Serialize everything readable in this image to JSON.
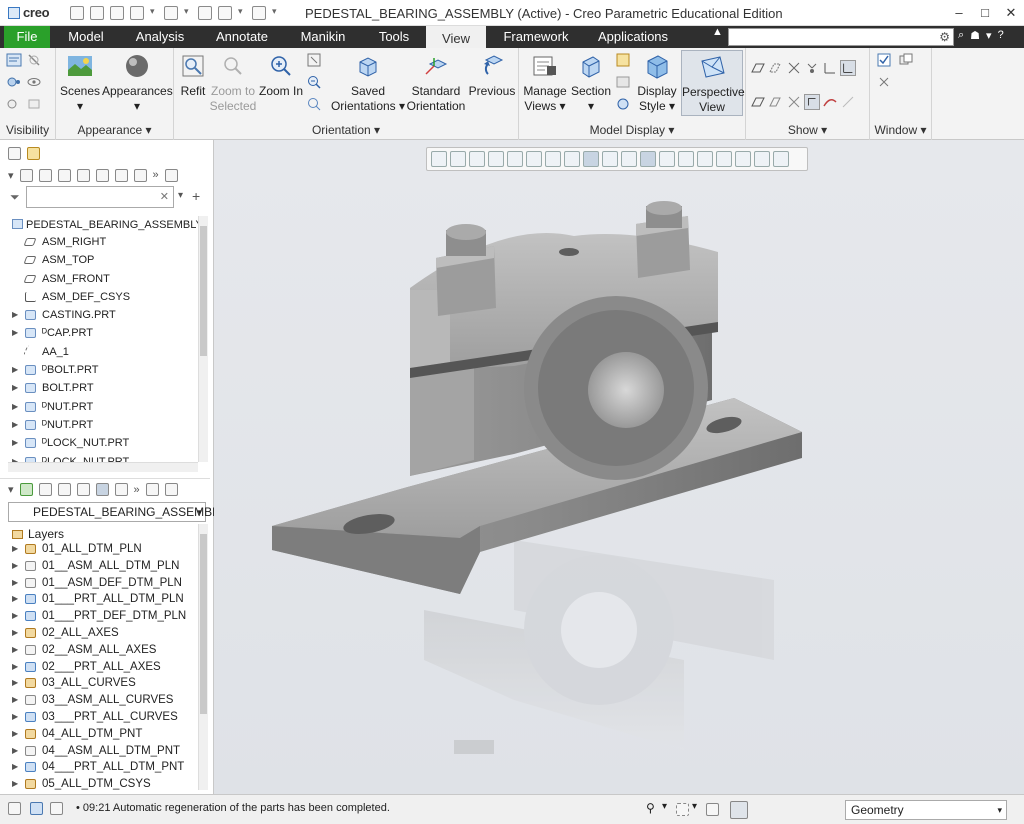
{
  "app": {
    "logo": "creo",
    "window_title": "PEDESTAL_BEARING_ASSEMBLY (Active) - Creo Parametric Educational Edition"
  },
  "window_controls": {
    "minimize": "–",
    "maximize": "□",
    "close": "✕"
  },
  "tabs": [
    {
      "label": "File"
    },
    {
      "label": "Model"
    },
    {
      "label": "Analysis"
    },
    {
      "label": "Annotate"
    },
    {
      "label": "Manikin"
    },
    {
      "label": "Tools"
    },
    {
      "label": "View"
    },
    {
      "label": "Framework"
    },
    {
      "label": "Applications"
    }
  ],
  "active_tab": "View",
  "ribbon": {
    "groups": {
      "visibility": "Visibility",
      "appearance": "Appearance ▾",
      "orientation": "Orientation ▾",
      "model_display": "Model Display ▾",
      "show": "Show ▾",
      "window": "Window ▾"
    },
    "buttons": {
      "scenes": "Scenes",
      "appearances": "Appearances",
      "refit": "Refit",
      "zoom_to_selected_1": "Zoom to",
      "zoom_to_selected_2": "Selected",
      "zoom_in": "Zoom In",
      "saved_orientations_1": "Saved",
      "saved_orientations_2": "Orientations ▾",
      "standard_orientation_1": "Standard",
      "standard_orientation_2": "Orientation",
      "previous": "Previous",
      "manage_views_1": "Manage",
      "manage_views_2": "Views ▾",
      "section": "Section",
      "display_style_1": "Display",
      "display_style_2": "Style ▾",
      "perspective_view_1": "Perspective",
      "perspective_view_2": "View"
    }
  },
  "model_tree": {
    "root": "PEDESTAL_BEARING_ASSEMBLY.ASM",
    "items": [
      {
        "label": "ASM_RIGHT",
        "type": "plane",
        "expandable": false
      },
      {
        "label": "ASM_TOP",
        "type": "plane",
        "expandable": false
      },
      {
        "label": "ASM_FRONT",
        "type": "plane",
        "expandable": false
      },
      {
        "label": "ASM_DEF_CSYS",
        "type": "csys",
        "expandable": false
      },
      {
        "label": "CASTING.PRT",
        "type": "part",
        "expandable": true
      },
      {
        "label": "ᴰCAP.PRT",
        "type": "part",
        "expandable": true
      },
      {
        "label": "AA_1",
        "type": "axis",
        "expandable": false
      },
      {
        "label": "ᴰBOLT.PRT",
        "type": "part",
        "expandable": true
      },
      {
        "label": "BOLT.PRT",
        "type": "part",
        "expandable": true
      },
      {
        "label": "ᴰNUT.PRT",
        "type": "part",
        "expandable": true
      },
      {
        "label": "ᴰNUT.PRT",
        "type": "part",
        "expandable": true
      },
      {
        "label": "ᴰLOCK_NUT.PRT",
        "type": "part",
        "expandable": true
      },
      {
        "label": "ᴰLOCK_NUT.PRT",
        "type": "part",
        "expandable": true
      }
    ]
  },
  "layer_tree": {
    "selected": "PEDESTAL_BEARING_ASSEMBLY",
    "header": "Layers",
    "items": [
      {
        "label": "01_ALL_DTM_PLN",
        "kind": "layer"
      },
      {
        "label": "01__ASM_ALL_DTM_PLN",
        "kind": "layer2"
      },
      {
        "label": "01__ASM_DEF_DTM_PLN",
        "kind": "layer2"
      },
      {
        "label": "01___PRT_ALL_DTM_PLN",
        "kind": "layer3"
      },
      {
        "label": "01___PRT_DEF_DTM_PLN",
        "kind": "layer3"
      },
      {
        "label": "02_ALL_AXES",
        "kind": "layer"
      },
      {
        "label": "02__ASM_ALL_AXES",
        "kind": "layer2"
      },
      {
        "label": "02___PRT_ALL_AXES",
        "kind": "layer3"
      },
      {
        "label": "03_ALL_CURVES",
        "kind": "layer"
      },
      {
        "label": "03__ASM_ALL_CURVES",
        "kind": "layer2"
      },
      {
        "label": "03___PRT_ALL_CURVES",
        "kind": "layer3"
      },
      {
        "label": "04_ALL_DTM_PNT",
        "kind": "layer"
      },
      {
        "label": "04__ASM_ALL_DTM_PNT",
        "kind": "layer2"
      },
      {
        "label": "04___PRT_ALL_DTM_PNT",
        "kind": "layer3"
      },
      {
        "label": "05_ALL_DTM_CSYS",
        "kind": "layer"
      }
    ]
  },
  "status": {
    "message": "• 09:21 Automatic regeneration of the parts has been completed.",
    "filter": "Geometry"
  }
}
